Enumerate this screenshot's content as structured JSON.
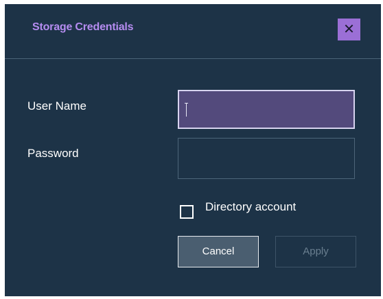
{
  "dialog": {
    "title": "Storage Credentials",
    "close_label": "✕",
    "close_icon": "close-icon"
  },
  "form": {
    "username": {
      "label": "User Name",
      "value": ""
    },
    "password": {
      "label": "Password",
      "value": ""
    },
    "directory_account": {
      "label": "Directory account",
      "checked": false
    }
  },
  "buttons": {
    "cancel_label": "Cancel",
    "apply_label": "Apply"
  },
  "colors": {
    "background": "#1d3347",
    "title": "#b58cf0",
    "close_button": "#9b6fd6",
    "focused_input": "#534a7c"
  }
}
